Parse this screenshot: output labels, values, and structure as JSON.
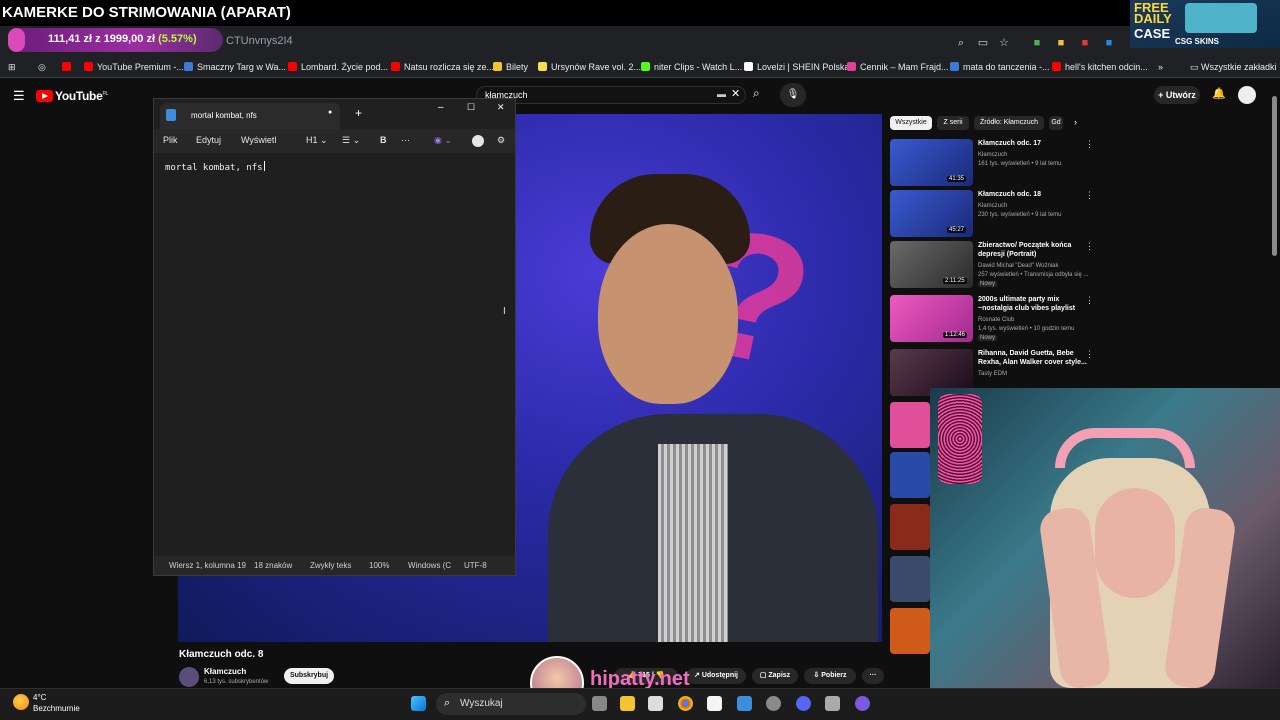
{
  "stream": {
    "banner_title": "KAMERKE DO STRIMOWANIA (APARAT)",
    "donation_amount": "111,41 zł z 1999,00 zł",
    "donation_percent": "(5.57%)",
    "donation_progress": 0.0557,
    "url_fragment": "CTUnvnys2I4",
    "promo_free": "FREE",
    "promo_daily": "DAILY",
    "promo_case": "CASE",
    "promo_brand": "CSG SKINS",
    "overlay_brand": "hipatty.net"
  },
  "browser": {
    "bookmarks": [
      {
        "label": "YouTube Premium -...",
        "color": "#ff0000"
      },
      {
        "label": "Smaczny Targ w Wa...",
        "color": "#3a7bd5"
      },
      {
        "label": "Lombard. Życie pod...",
        "color": "#ff0000"
      },
      {
        "label": "Natsu rozlicza się ze...",
        "color": "#ff0000"
      },
      {
        "label": "Bilety",
        "color": "#f4c430"
      },
      {
        "label": "Ursynów Rave vol. 2...",
        "color": "#f4e04d"
      },
      {
        "label": "niter Clips - Watch L...",
        "color": "#53fc18"
      },
      {
        "label": "Lovelzi | SHEIN Polska",
        "color": "#ffffff"
      },
      {
        "label": "Cennik – Mam Frajd...",
        "color": "#e0409a"
      },
      {
        "label": "mata do tanczenia -...",
        "color": "#3a7bd5"
      },
      {
        "label": "hell's kitchen odcin...",
        "color": "#ff0000"
      }
    ],
    "all_bookmarks": "Wszystkie zakładki"
  },
  "youtube": {
    "logo_text": "YouTube",
    "logo_region": "PL",
    "search_value": "kłamczuch",
    "create_label": "Utwórz",
    "video_title": "Kłamczuch odc. 8",
    "channel_name": "Kłamczuch",
    "channel_subs": "6,13 tys. subskrybentów",
    "subscribe_label": "Subskrybuj",
    "likes": "715",
    "share_label": "Udostępnij",
    "save_label": "Zapisz",
    "download_label": "Pobierz",
    "chips": [
      "Wszystkie",
      "Z serii",
      "Źródło: Kłamczuch",
      "Gd"
    ],
    "recommendations": [
      {
        "title": "Kłamczuch odc. 17",
        "channel": "Kłamczuch",
        "meta": "161 tys. wyświetleń • 9 lat temu",
        "duration": "41:35",
        "badge": "",
        "color": "#2a4aa8"
      },
      {
        "title": "Kłamczuch odc. 18",
        "channel": "Kłamczuch",
        "meta": "230 tys. wyświetleń • 9 lat temu",
        "duration": "45:27",
        "badge": "",
        "color": "#2a4aa8"
      },
      {
        "title": "Zbieractwo/ Początek końca depresji (Portrait)",
        "channel": "Dawid Michał \"Dead\" Woźniak",
        "meta": "257 wyświetleń • Transmisja odbyła się ...",
        "duration": "2:11:25",
        "badge": "Nowy",
        "color": "#4a4a4a"
      },
      {
        "title": "2000s ultimate party mix ~nostalgia club vibes playlist",
        "channel": "Rosnate Club",
        "meta": "1,4 tys. wyświetleń • 10 godzin temu",
        "duration": "1:12:46",
        "badge": "Nowy",
        "color": "#d23aa8"
      },
      {
        "title": "Rihanna, David Guetta, Bebe Rexha, Alan Walker cover style...",
        "channel": "Tasty EDM",
        "meta": "",
        "duration": "",
        "badge": "",
        "color": "#3a2a3a"
      }
    ]
  },
  "notepad": {
    "tab_title": "mortal kombat, nfs",
    "menu": [
      "Plik",
      "Edytuj",
      "Wyświetl"
    ],
    "heading_label": "H1",
    "bold_label": "B",
    "content": "mortal kombat, nfs",
    "status_position": "Wiersz 1, kolumna 19",
    "status_chars": "18 znaków",
    "status_format": "Zwykły teks",
    "status_zoom": "100%",
    "status_eol": "Windows (C",
    "status_encoding": "UTF-8"
  },
  "taskbar": {
    "temperature": "4°C",
    "weather": "Bezchmurnie",
    "search_placeholder": "Wyszukaj"
  }
}
